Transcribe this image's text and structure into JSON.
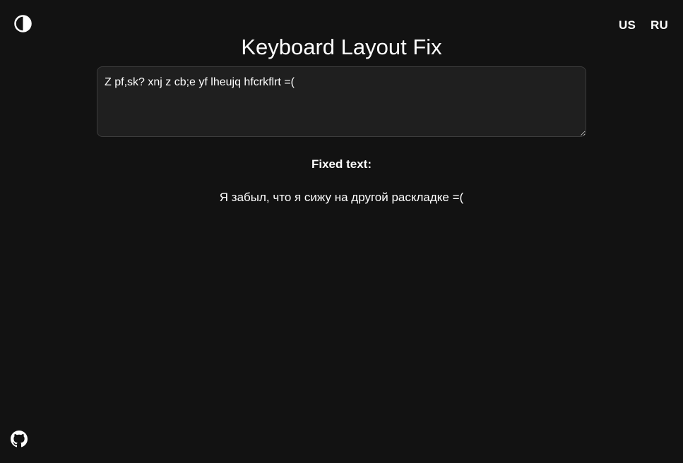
{
  "header": {
    "title": "Keyboard Layout Fix",
    "theme_toggle_icon": "contrast-half-circle-icon",
    "languages": [
      "US",
      "RU"
    ]
  },
  "input": {
    "value": "Z pf,sk? xnj z cb;e yf lheujq hfcrkflrt =("
  },
  "output": {
    "label": "Fixed text:",
    "text": "Я забыл, что я сижу на другой раскладке =("
  },
  "footer": {
    "github_icon": "github-icon"
  },
  "colors": {
    "background": "#121212",
    "input_background": "#1f1f1f",
    "input_border": "#3c3c3c",
    "text": "#ffffff"
  }
}
